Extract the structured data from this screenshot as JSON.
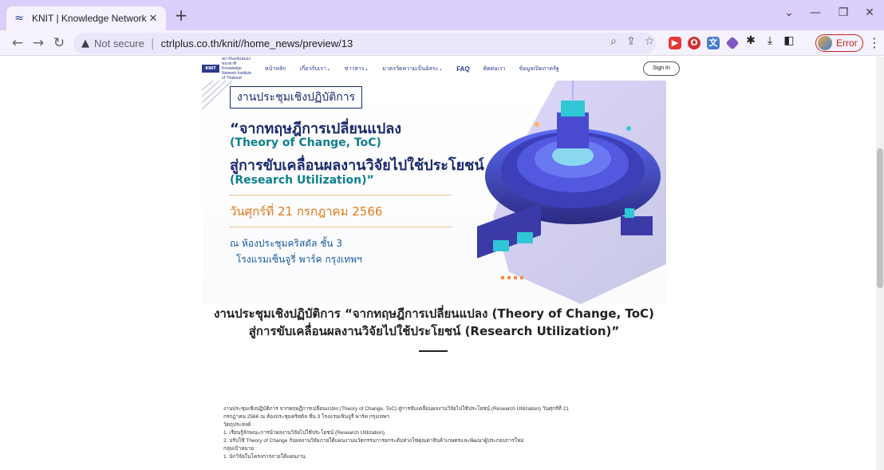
{
  "browser": {
    "tab_title": "KNIT | Knowledge Network Instit",
    "tab_close": "✕",
    "new_tab": "+",
    "security_label": "Not secure",
    "url": "ctrlplus.co.th/knit//home_news/preview/13",
    "profile_status": "Error",
    "window_controls": [
      "⌄",
      "—",
      "❐",
      "✕"
    ]
  },
  "site": {
    "logo_mark": "KNIT",
    "logo_text": "สถาบันคลังสมองของชาติ Knowledge Network Institute of Thailand",
    "nav": [
      "หน้าหลัก",
      "เกี่ยวกับเรา⌄",
      "ข่าวสาร⌄",
      "มาตรวัดความเป็นอิสระ⌄",
      "FAQ",
      "ติดต่อเรา",
      "ข้อมูลเปิดภาครัฐ"
    ],
    "sign_in": "Sign In"
  },
  "banner": {
    "event_type": "งานประชุมเชิงปฏิบัติการ",
    "title_line1": "“จากทฤษฎีการเปลี่ยนแปลง",
    "title_line2": "(Theory of Change, ToC)",
    "title_line3": "สู่การขับเคลื่อนผลงานวิจัยไปใช้ประโยชน์",
    "title_line4": "(Research Utilization)”",
    "date": "วันศุกร์ที่ 21 กรกฎาคม 2566",
    "venue_line1": "ณ ห้องประชุมคริสตัล ชั้น 3",
    "venue_line2": "โรงแรมเซ็นจูรี่ พาร์ค กรุงเทพฯ"
  },
  "article": {
    "headline_line1": "งานประชุมเชิงปฏิบัติการ “จากทฤษฎีการเปลี่ยนแปลง (Theory of Change, ToC)",
    "headline_line2": "สู่การขับเคลื่อนผลงานวิจัยไปใช้ประโยชน์ (Research Utilization)”",
    "body": [
      "งานประชุมเชิงปฏิบัติการ จากทฤษฎีการเปลี่ยนแปลง (Theory of Change, ToC) สู่การขับเคลื่อนผลงานวิจัยไปใช้ประโยชน์ (Research Utilization) วันศุกร์ที่ 21",
      "กรกฎาคม 2566 ณ ห้องประชุมคริสตัล ชั้น 3 โรงแรมเซ็นจูรี่ พาร์ค กรุงเทพฯ",
      "วัตถุประสงค์ :",
      "1. เรียนรู้ลักษณะการนำผลงานวิจัยไปใช้ประโยชน์ (Research Utilization)",
      "2. ปรับใช้ Theory of Change กับผลงานวิจัยภายใต้แผนงานนวัตกรรมการยกระดับห่วงโซ่คุณค่าสินค้าเกษตรและพัฒนาผู้ประกอบการใหม่",
      "กลุ่มเป้าหมาย :",
      "1. นักวิจัยในโครงการภายใต้แผนงาน"
    ]
  },
  "colors": {
    "tabstrip": "#d9cffa",
    "brand_navy": "#1a2b6d",
    "brand_teal": "#0c7f8e",
    "accent_orange": "#e07a1c",
    "error_red": "#c5221f"
  }
}
